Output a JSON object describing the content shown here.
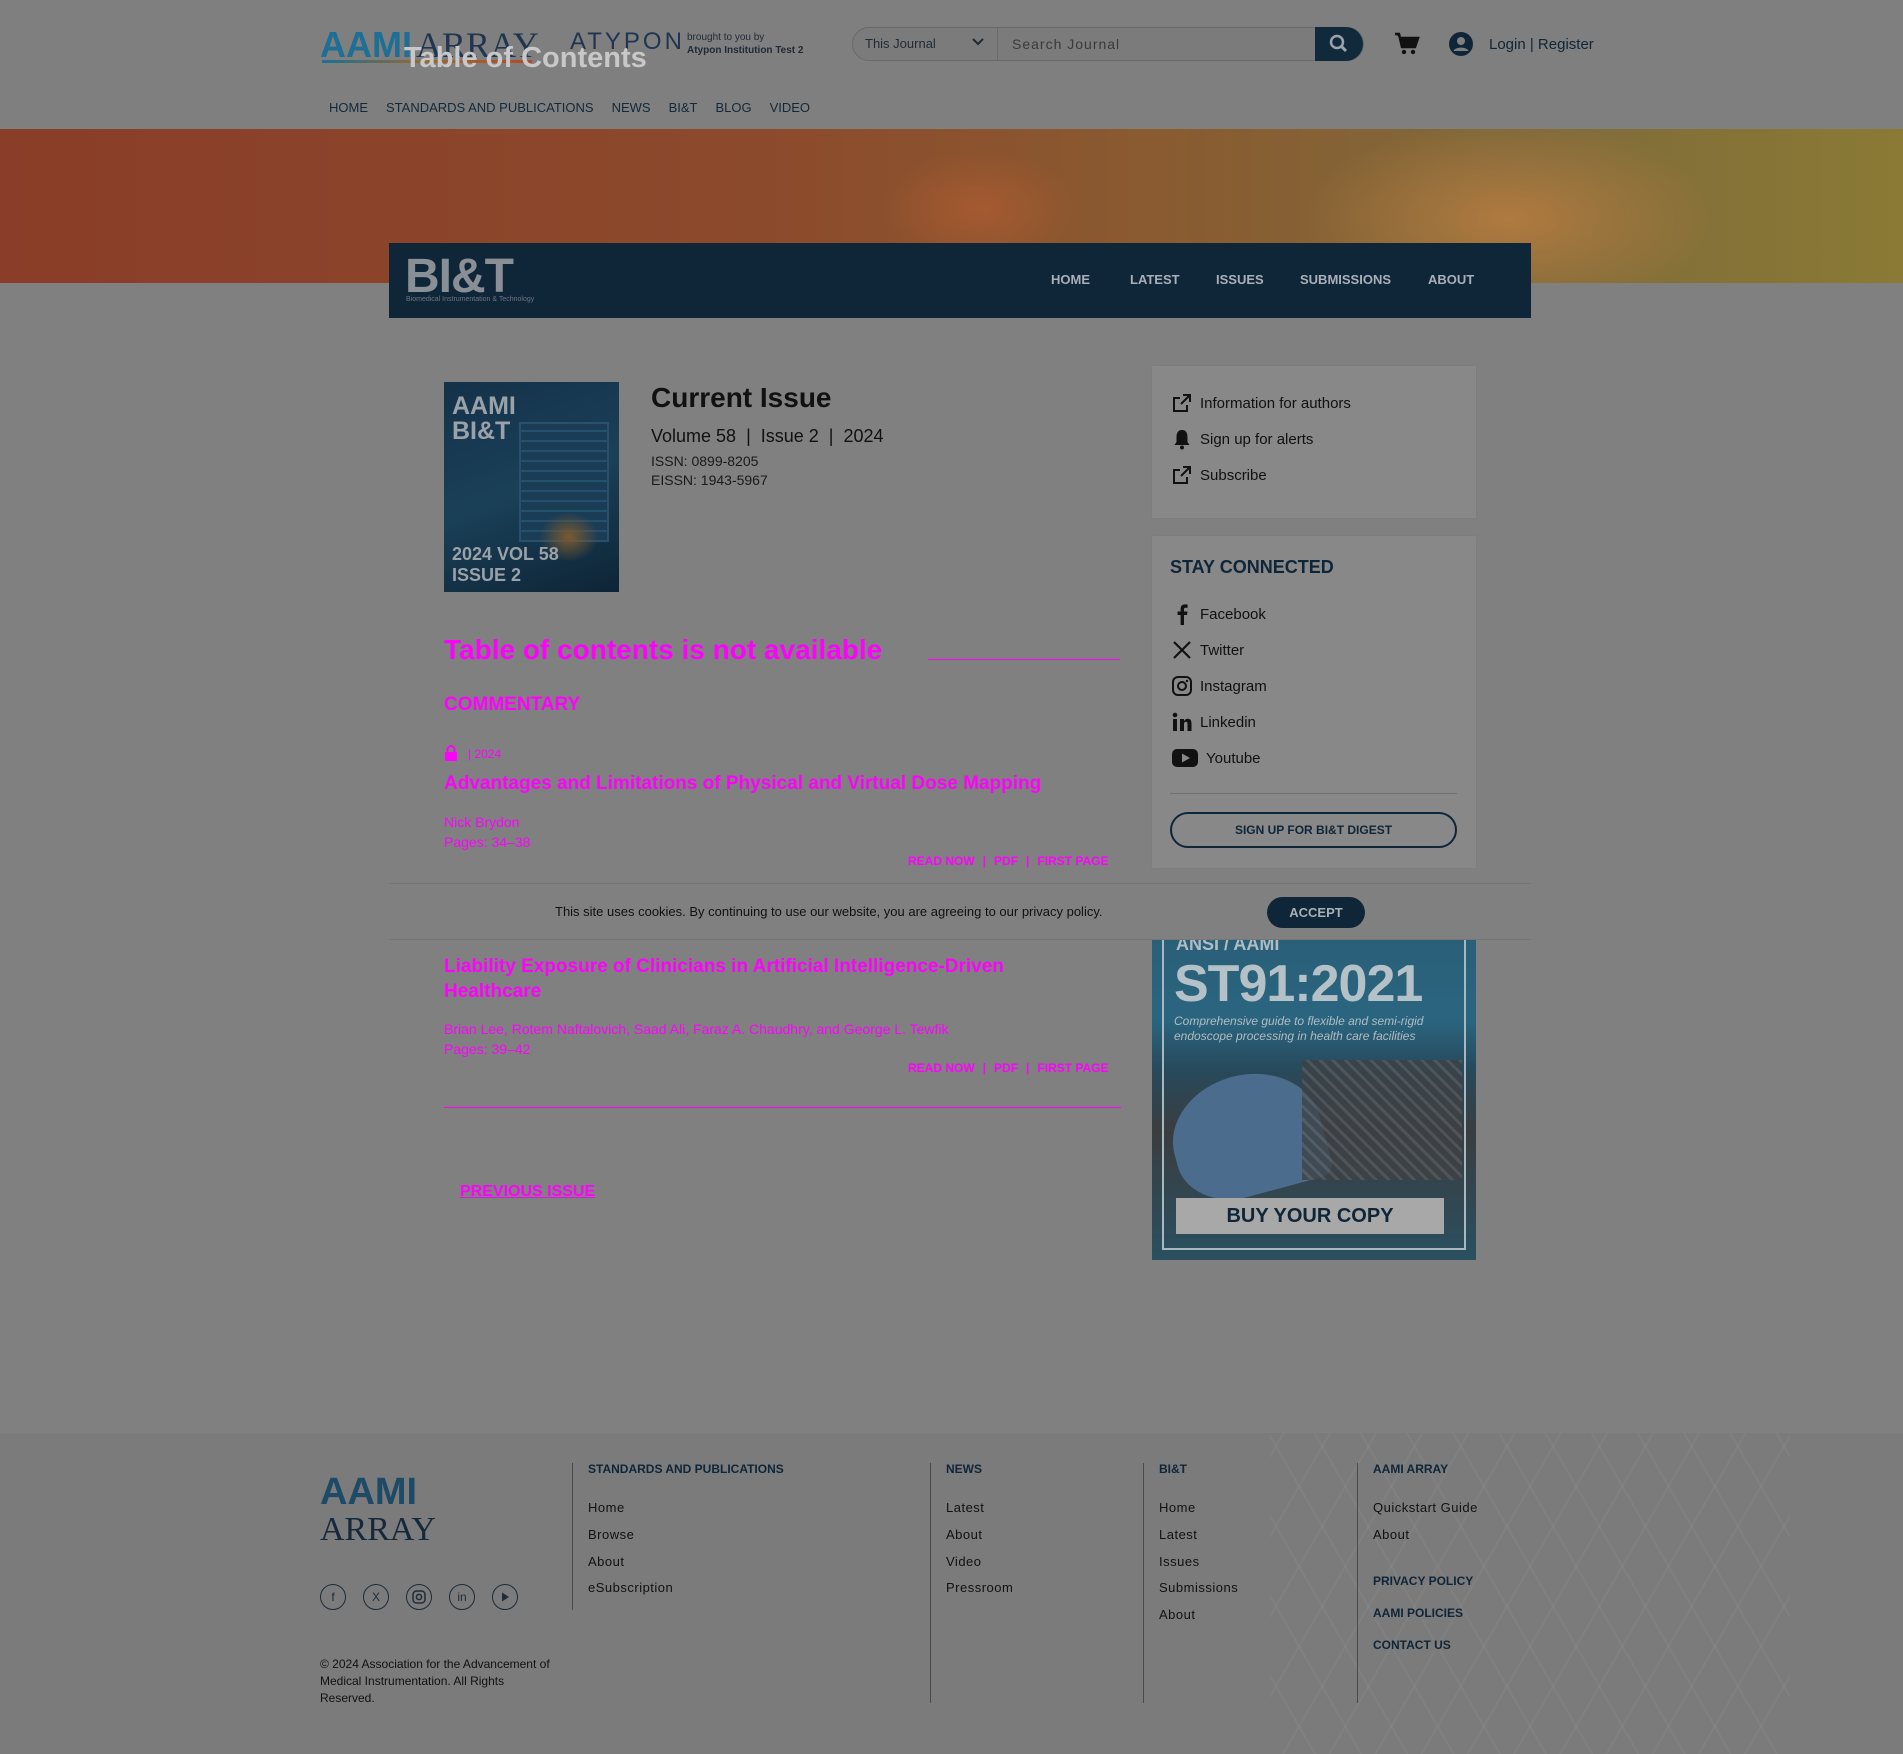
{
  "header": {
    "logo_part1": "AAMI",
    "logo_part2": "ARRAY",
    "atypon": "ATYPON",
    "brought_by": "brought to you by",
    "institution": "Atypon Institution Test 2",
    "search_scope": "This Journal",
    "search_placeholder": "Search Journal",
    "login": "Login | Register"
  },
  "top_nav": [
    "HOME",
    "STANDARDS AND PUBLICATIONS",
    "NEWS",
    "BI&T",
    "BLOG",
    "VIDEO"
  ],
  "hero": {
    "title": "Table of Contents"
  },
  "journal_bar": {
    "logo": "BI&T",
    "logo_sub": "Biomedical Instrumentation & Technology",
    "nav": [
      "HOME",
      "LATEST",
      "ISSUES",
      "SUBMISSIONS",
      "ABOUT"
    ]
  },
  "cover": {
    "brand": "AAMI BI&T",
    "line1": "2024 VOL 58",
    "line2": "ISSUE 2"
  },
  "current_issue": {
    "title": "Current Issue",
    "volume": "Volume 58",
    "issue": "Issue 2",
    "year": "2024",
    "issn": "ISSN: 0899-8205",
    "eissn": "EISSN: 1943-5967"
  },
  "toc": {
    "not_available": "Table of contents is not available",
    "section": "COMMENTARY",
    "articles": [
      {
        "meta": "|   2024",
        "title": "Advantages and Limitations of Physical and Virtual Dose Mapping",
        "authors": "Nick Brydon",
        "pages": "Pages: 34–38"
      },
      {
        "title": "Liability Exposure of Clinicians in Artificial Intelligence-Driven Healthcare",
        "authors": "Brian Lee, Rotem Naftalovich, Saad Ali, Faraz A. Chaudhry, and George L. Tewfik",
        "pages": "Pages: 39–42"
      }
    ],
    "links": {
      "read": "READ NOW",
      "pdf": "PDF",
      "first": "FIRST PAGE"
    },
    "previous": "PREVIOUS ISSUE"
  },
  "sidebar": {
    "links": [
      "Information for authors",
      "Sign up for alerts",
      "Subscribe"
    ],
    "stay_connected": "STAY CONNECTED",
    "social": [
      "Facebook",
      "Twitter",
      "Instagram",
      "Linkedin",
      "Youtube"
    ],
    "digest": "SIGN UP FOR BI&T DIGEST"
  },
  "ad": {
    "org": "ANSI / AAMI",
    "standard": "ST91:2021",
    "guide": "Comprehensive guide to flexible and semi-rigid endoscope processing in health care facilities",
    "cta": "BUY YOUR COPY"
  },
  "cookie": {
    "text": "This site uses cookies. By continuing to use our website, you are agreeing to our privacy policy.",
    "accept": "ACCEPT"
  },
  "footer": {
    "logo_part1": "AAMI",
    "logo_part2": "ARRAY",
    "copyright": "© 2024 Association for the Advancement of Medical Instrumentation. All Rights Reserved.",
    "col1": {
      "head": "STANDARDS AND PUBLICATIONS",
      "links": [
        "Home",
        "Browse",
        "About",
        "eSubscription"
      ]
    },
    "col2": {
      "head": "NEWS",
      "links": [
        "Latest",
        "About",
        "Video",
        "Pressroom"
      ]
    },
    "col3": {
      "head": "BI&T",
      "links": [
        "Home",
        "Latest",
        "Issues",
        "Submissions",
        "About"
      ]
    },
    "col4": {
      "head": "AAMI ARRAY",
      "links": [
        "Quickstart Guide",
        "About"
      ],
      "bold_links": [
        "PRIVACY POLICY",
        "AAMI POLICIES",
        "CONTACT US"
      ]
    }
  },
  "colors": {
    "accent": "#ff00ff",
    "navy": "#0f2538"
  }
}
